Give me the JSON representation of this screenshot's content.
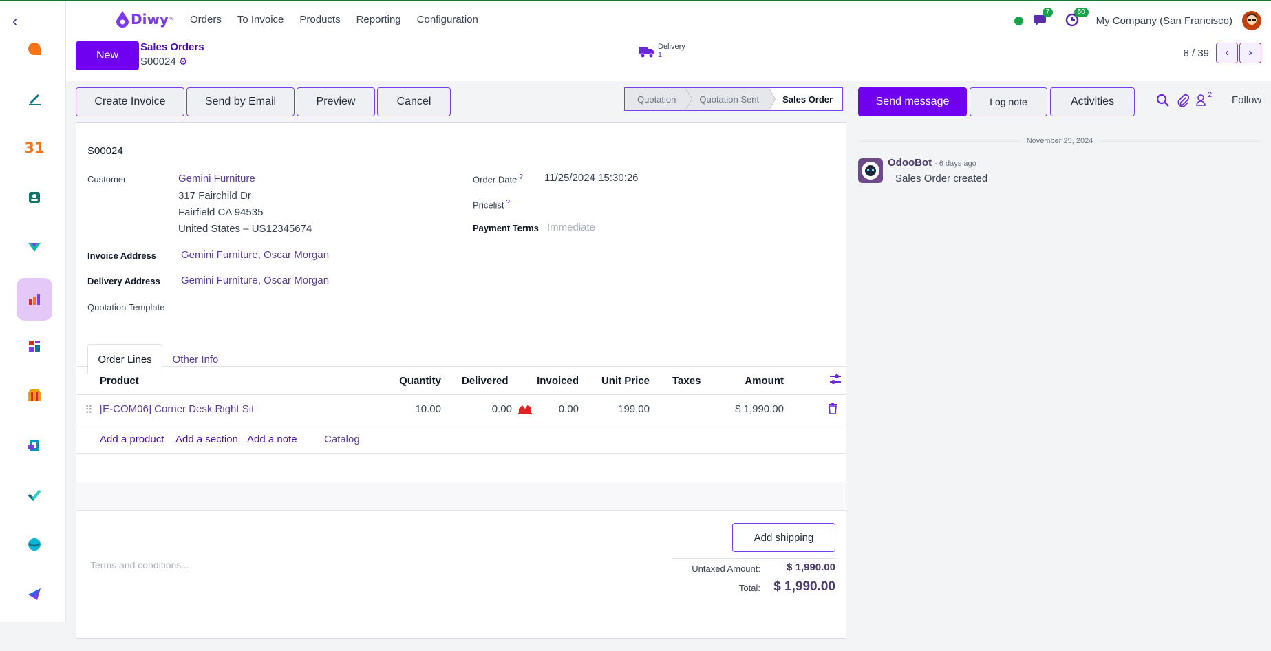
{
  "navbar": {
    "brand": "Diwy",
    "brand_mark": "™",
    "menu": [
      "Orders",
      "To Invoice",
      "Products",
      "Reporting",
      "Configuration"
    ],
    "chat_count": "7",
    "activity_count": "50",
    "company": "My Company (San Francisco)"
  },
  "rail": {
    "icons": [
      "chat-bubble-icon",
      "pen-icon",
      "calendar-icon",
      "contacts-icon",
      "crm-icon",
      "sales-chart-icon",
      "dashboard-icon",
      "shop-icon",
      "invoice-icon",
      "check-icon",
      "discuss-icon",
      "send-icon"
    ],
    "calendar_text": "31",
    "active_index": 5,
    "accent": "#7000f0"
  },
  "control": {
    "new_label": "New",
    "breadcrumb_parent": "Sales Orders",
    "record_name": "S00024",
    "delivery_label": "Delivery",
    "delivery_count": "1",
    "pager_value": "8 / 39"
  },
  "actions": {
    "create_invoice": "Create Invoice",
    "send_email": "Send by Email",
    "preview": "Preview",
    "cancel": "Cancel"
  },
  "statusbar": {
    "stages": [
      "Quotation",
      "Quotation Sent",
      "Sales Order"
    ],
    "current": "Sales Order"
  },
  "form": {
    "order_ref": "S00024",
    "customer_label": "Customer",
    "customer_name": "Gemini Furniture",
    "customer_street": "317 Fairchild Dr",
    "customer_city": "Fairfield CA 94535",
    "customer_country": "United States – US12345674",
    "invoice_address_label": "Invoice Address",
    "invoice_address": "Gemini Furniture, Oscar Morgan",
    "delivery_address_label": "Delivery Address",
    "delivery_address": "Gemini Furniture, Oscar Morgan",
    "quotation_template_label": "Quotation Template",
    "order_date_label": "Order Date",
    "order_date": "11/25/2024 15:30:26",
    "pricelist_label": "Pricelist",
    "payment_terms_label": "Payment Terms",
    "payment_terms_placeholder": "Immediate",
    "help_mark": "?"
  },
  "tabs": [
    "Order Lines",
    "Other Info"
  ],
  "order_lines": {
    "columns": [
      "Product",
      "Quantity",
      "Delivered",
      "Invoiced",
      "Unit Price",
      "Taxes",
      "Amount"
    ],
    "rows": [
      {
        "product": "[E-COM06] Corner Desk Right Sit",
        "quantity": "10.00",
        "delivered": "0.00",
        "invoiced": "0.00",
        "unit_price": "199.00",
        "taxes": "",
        "amount": "$ 1,990.00"
      }
    ],
    "add_product": "Add a product",
    "add_section": "Add a section",
    "add_note": "Add a note",
    "catalog": "Catalog"
  },
  "footer": {
    "terms_placeholder": "Terms and conditions...",
    "add_shipping": "Add shipping",
    "untaxed_label": "Untaxed Amount:",
    "untaxed_value": "$ 1,990.00",
    "total_label": "Total:",
    "total_value": "$ 1,990.00"
  },
  "chatter": {
    "send_message": "Send message",
    "log_note": "Log note",
    "activities": "Activities",
    "followers_count": "2",
    "follow": "Follow",
    "date_separator": "November 25, 2024",
    "messages": [
      {
        "author": "OdooBot",
        "time": "- 6 days ago",
        "body": "Sales Order created"
      }
    ]
  }
}
